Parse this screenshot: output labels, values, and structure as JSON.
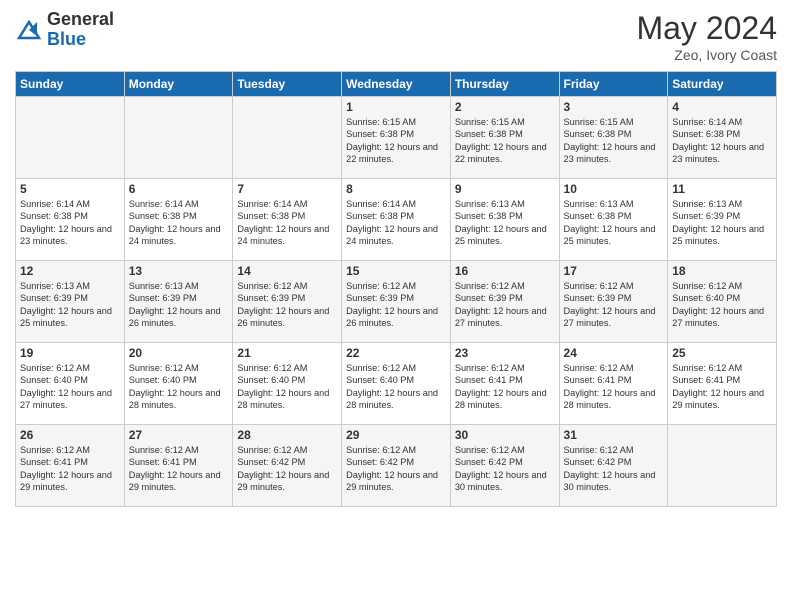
{
  "header": {
    "logo_general": "General",
    "logo_blue": "Blue",
    "month_title": "May 2024",
    "location": "Zeo, Ivory Coast"
  },
  "days_of_week": [
    "Sunday",
    "Monday",
    "Tuesday",
    "Wednesday",
    "Thursday",
    "Friday",
    "Saturday"
  ],
  "weeks": [
    [
      {
        "day": "",
        "info": ""
      },
      {
        "day": "",
        "info": ""
      },
      {
        "day": "",
        "info": ""
      },
      {
        "day": "1",
        "info": "Sunrise: 6:15 AM\nSunset: 6:38 PM\nDaylight: 12 hours and 22 minutes."
      },
      {
        "day": "2",
        "info": "Sunrise: 6:15 AM\nSunset: 6:38 PM\nDaylight: 12 hours and 22 minutes."
      },
      {
        "day": "3",
        "info": "Sunrise: 6:15 AM\nSunset: 6:38 PM\nDaylight: 12 hours and 23 minutes."
      },
      {
        "day": "4",
        "info": "Sunrise: 6:14 AM\nSunset: 6:38 PM\nDaylight: 12 hours and 23 minutes."
      }
    ],
    [
      {
        "day": "5",
        "info": "Sunrise: 6:14 AM\nSunset: 6:38 PM\nDaylight: 12 hours and 23 minutes."
      },
      {
        "day": "6",
        "info": "Sunrise: 6:14 AM\nSunset: 6:38 PM\nDaylight: 12 hours and 24 minutes."
      },
      {
        "day": "7",
        "info": "Sunrise: 6:14 AM\nSunset: 6:38 PM\nDaylight: 12 hours and 24 minutes."
      },
      {
        "day": "8",
        "info": "Sunrise: 6:14 AM\nSunset: 6:38 PM\nDaylight: 12 hours and 24 minutes."
      },
      {
        "day": "9",
        "info": "Sunrise: 6:13 AM\nSunset: 6:38 PM\nDaylight: 12 hours and 25 minutes."
      },
      {
        "day": "10",
        "info": "Sunrise: 6:13 AM\nSunset: 6:38 PM\nDaylight: 12 hours and 25 minutes."
      },
      {
        "day": "11",
        "info": "Sunrise: 6:13 AM\nSunset: 6:39 PM\nDaylight: 12 hours and 25 minutes."
      }
    ],
    [
      {
        "day": "12",
        "info": "Sunrise: 6:13 AM\nSunset: 6:39 PM\nDaylight: 12 hours and 25 minutes."
      },
      {
        "day": "13",
        "info": "Sunrise: 6:13 AM\nSunset: 6:39 PM\nDaylight: 12 hours and 26 minutes."
      },
      {
        "day": "14",
        "info": "Sunrise: 6:12 AM\nSunset: 6:39 PM\nDaylight: 12 hours and 26 minutes."
      },
      {
        "day": "15",
        "info": "Sunrise: 6:12 AM\nSunset: 6:39 PM\nDaylight: 12 hours and 26 minutes."
      },
      {
        "day": "16",
        "info": "Sunrise: 6:12 AM\nSunset: 6:39 PM\nDaylight: 12 hours and 27 minutes."
      },
      {
        "day": "17",
        "info": "Sunrise: 6:12 AM\nSunset: 6:39 PM\nDaylight: 12 hours and 27 minutes."
      },
      {
        "day": "18",
        "info": "Sunrise: 6:12 AM\nSunset: 6:40 PM\nDaylight: 12 hours and 27 minutes."
      }
    ],
    [
      {
        "day": "19",
        "info": "Sunrise: 6:12 AM\nSunset: 6:40 PM\nDaylight: 12 hours and 27 minutes."
      },
      {
        "day": "20",
        "info": "Sunrise: 6:12 AM\nSunset: 6:40 PM\nDaylight: 12 hours and 28 minutes."
      },
      {
        "day": "21",
        "info": "Sunrise: 6:12 AM\nSunset: 6:40 PM\nDaylight: 12 hours and 28 minutes."
      },
      {
        "day": "22",
        "info": "Sunrise: 6:12 AM\nSunset: 6:40 PM\nDaylight: 12 hours and 28 minutes."
      },
      {
        "day": "23",
        "info": "Sunrise: 6:12 AM\nSunset: 6:41 PM\nDaylight: 12 hours and 28 minutes."
      },
      {
        "day": "24",
        "info": "Sunrise: 6:12 AM\nSunset: 6:41 PM\nDaylight: 12 hours and 28 minutes."
      },
      {
        "day": "25",
        "info": "Sunrise: 6:12 AM\nSunset: 6:41 PM\nDaylight: 12 hours and 29 minutes."
      }
    ],
    [
      {
        "day": "26",
        "info": "Sunrise: 6:12 AM\nSunset: 6:41 PM\nDaylight: 12 hours and 29 minutes."
      },
      {
        "day": "27",
        "info": "Sunrise: 6:12 AM\nSunset: 6:41 PM\nDaylight: 12 hours and 29 minutes."
      },
      {
        "day": "28",
        "info": "Sunrise: 6:12 AM\nSunset: 6:42 PM\nDaylight: 12 hours and 29 minutes."
      },
      {
        "day": "29",
        "info": "Sunrise: 6:12 AM\nSunset: 6:42 PM\nDaylight: 12 hours and 29 minutes."
      },
      {
        "day": "30",
        "info": "Sunrise: 6:12 AM\nSunset: 6:42 PM\nDaylight: 12 hours and 30 minutes."
      },
      {
        "day": "31",
        "info": "Sunrise: 6:12 AM\nSunset: 6:42 PM\nDaylight: 12 hours and 30 minutes."
      },
      {
        "day": "",
        "info": ""
      }
    ]
  ]
}
